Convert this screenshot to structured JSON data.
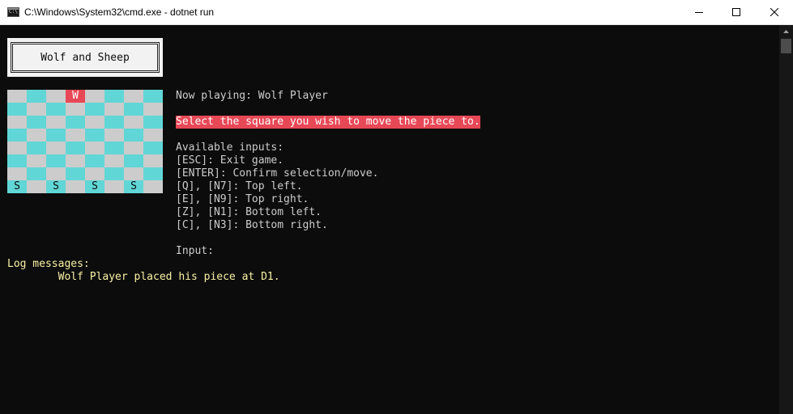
{
  "window": {
    "title": "C:\\Windows\\System32\\cmd.exe - dotnet  run",
    "icon": "console-app-icon"
  },
  "header_box": {
    "title": "Wolf and Sheep"
  },
  "board": {
    "rows": 8,
    "cols": 8,
    "colors": {
      "light": "#cccccc",
      "dark": "#61d6d6",
      "wolf_highlight": "#e74856"
    },
    "pieces": [
      {
        "label": "W",
        "row": 0,
        "col": 3,
        "highlight": true
      },
      {
        "label": "S",
        "row": 7,
        "col": 0
      },
      {
        "label": "S",
        "row": 7,
        "col": 2
      },
      {
        "label": "S",
        "row": 7,
        "col": 4
      },
      {
        "label": "S",
        "row": 7,
        "col": 6
      }
    ]
  },
  "info": {
    "now_playing": "Now playing: Wolf Player",
    "instruction": "Select the square you wish to move the piece to.",
    "inputs_title": "Available inputs:",
    "inputs": [
      "[ESC]: Exit game.",
      "[ENTER]: Confirm selection/move.",
      "[Q], [N7]: Top left.",
      "[E], [N9]: Top right.",
      "[Z], [N1]: Bottom left.",
      "[C], [N3]: Bottom right."
    ],
    "input_prompt": "Input:"
  },
  "log": {
    "title": "Log messages:",
    "messages": [
      "        Wolf Player placed his piece at D1."
    ]
  },
  "colors": {
    "console_bg": "#0c0c0c",
    "console_text": "#cccccc",
    "highlight_bg": "#e74856",
    "log_text": "#f9f1a5"
  }
}
